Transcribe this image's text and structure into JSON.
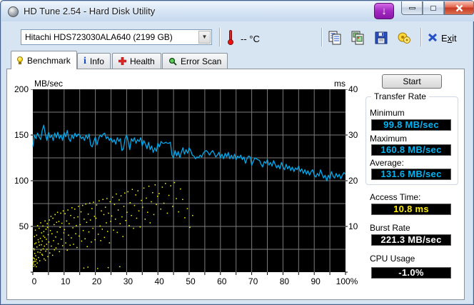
{
  "window": {
    "title": "HD Tune 2.54 - Hard Disk Utility"
  },
  "titlebar_icons": [
    "app-icon",
    "download-icon",
    "minimize-icon",
    "maximize-icon",
    "close-icon"
  ],
  "toolbar": {
    "drive_selector_value": "Hitachi HDS723030ALA640 (2199 GB)",
    "temperature_value": "--",
    "temperature_unit": "°C",
    "icons": [
      "thermometer-icon",
      "copy-text-icon",
      "copy-image-icon",
      "save-icon",
      "options-icon",
      "exit-icon"
    ],
    "exit": {
      "pre": "E",
      "accel": "x",
      "post": "it"
    }
  },
  "tabs": [
    {
      "label": "Benchmark",
      "icon": "benchmark-bulb-icon",
      "active": true
    },
    {
      "label": "Info",
      "icon": "info-icon",
      "active": false
    },
    {
      "label": "Health",
      "icon": "health-cross-icon",
      "active": false
    },
    {
      "label": "Error Scan",
      "icon": "error-scan-magnifier-icon",
      "active": false
    }
  ],
  "panel": {
    "start_label": "Start",
    "transfer_rate": {
      "title": "Transfer Rate",
      "minimum_label": "Minimum",
      "minimum_value": "99.8 MB/sec",
      "maximum_label": "Maximum",
      "maximum_value": "160.8 MB/sec",
      "average_label": "Average:",
      "average_value": "131.6 MB/sec"
    },
    "access_time_label": "Access Time:",
    "access_time_value": "10.8 ms",
    "burst_rate_label": "Burst Rate",
    "burst_rate_value": "221.3 MB/sec",
    "cpu_usage_label": "CPU Usage",
    "cpu_usage_value": "-1.0%"
  },
  "colors": {
    "plot_background": "#000000",
    "grid": "#7b7b7b",
    "transfer_line": "#00a8ec",
    "access_scatter": "#ffff00",
    "lcd_cyan": "#00b4f4",
    "lcd_yellow": "#ffec00",
    "lcd_white": "#ffffff"
  },
  "chart_data": {
    "type": "line",
    "title": "HD Tune benchmark: transfer rate line (left axis) + access time scatter (right axis)",
    "left_axis": {
      "label": "MB/sec",
      "min": 0,
      "max": 200,
      "tick_labels": [
        "200",
        "150",
        "100",
        "50"
      ],
      "tick_step": 50,
      "grid_step": 25
    },
    "right_axis": {
      "label": "ms",
      "min": 0,
      "max": 40,
      "tick_labels": [
        "40",
        "30",
        "20",
        "10"
      ],
      "tick_step": 10
    },
    "x_axis": {
      "min": 0,
      "max": 100,
      "tick_labels": [
        "0",
        "10",
        "20",
        "30",
        "40",
        "50",
        "60",
        "70",
        "80",
        "90",
        "100%"
      ],
      "grid_step_percent": 5
    },
    "grid": {
      "on": true,
      "color": "#7b7b7b"
    },
    "series": [
      {
        "name": "transfer-rate",
        "type": "line",
        "axis": "left",
        "color": "#00a8ec",
        "x_start": 0,
        "x_step": 0.5,
        "values_mbs": [
          137,
          150,
          146,
          152,
          148,
          145,
          155,
          160.8,
          151,
          144,
          153,
          147,
          150,
          144,
          152,
          147,
          153,
          146,
          150,
          144,
          153,
          148,
          155,
          146,
          143,
          150,
          146,
          152,
          148,
          151,
          150,
          146,
          148,
          144,
          150,
          146,
          151,
          139,
          137,
          143,
          148,
          139,
          146,
          150,
          148,
          151,
          152,
          146,
          148,
          144,
          147,
          142,
          145,
          140,
          147,
          143,
          146,
          133,
          135,
          146,
          150,
          143,
          134,
          146,
          143,
          147,
          141,
          145,
          143,
          147,
          138,
          144,
          140,
          135,
          142,
          134,
          138,
          131,
          136,
          132,
          141,
          137,
          143,
          141,
          141,
          142,
          141,
          141,
          142,
          128,
          125,
          133,
          127,
          132,
          125,
          131,
          136,
          129,
          134,
          130,
          136,
          133,
          128,
          127,
          124,
          126,
          125,
          128,
          126,
          130,
          132,
          133,
          131,
          128,
          131,
          133,
          130,
          126,
          128,
          131,
          125,
          129,
          124,
          130,
          126,
          131,
          124,
          128,
          124,
          129,
          123,
          127,
          125,
          128,
          123,
          126,
          119,
          124,
          127,
          126,
          117,
          121,
          125,
          124,
          123,
          122,
          118,
          115,
          121,
          119,
          123,
          117,
          120,
          116,
          122,
          118,
          114,
          117,
          113,
          120,
          115,
          112,
          118,
          113,
          116,
          111,
          115,
          110,
          114,
          112,
          116,
          110,
          113,
          108,
          112,
          107,
          111,
          106,
          110,
          112,
          106,
          104,
          108,
          105,
          112,
          107,
          103,
          106,
          99.8,
          106,
          102,
          110,
          105,
          103,
          108,
          104,
          107,
          102,
          106,
          109,
          107
        ]
      },
      {
        "name": "access-time",
        "type": "scatter",
        "axis": "right",
        "color": "#ffff00",
        "points_x_ms": [
          [
            0.2,
            3.1
          ],
          [
            0.3,
            5.2
          ],
          [
            0.4,
            2.4
          ],
          [
            0.5,
            7.8
          ],
          [
            0.6,
            4.1
          ],
          [
            0.8,
            9.2
          ],
          [
            0.9,
            3.6
          ],
          [
            1.0,
            6.4
          ],
          [
            1.1,
            2.8
          ],
          [
            1.2,
            8.1
          ],
          [
            1.3,
            5.5
          ],
          [
            1.5,
            10.2
          ],
          [
            1.6,
            4.4
          ],
          [
            1.7,
            7.1
          ],
          [
            1.8,
            3.2
          ],
          [
            2.0,
            9.6
          ],
          [
            2.1,
            5.9
          ],
          [
            2.2,
            2.5
          ],
          [
            2.4,
            7.4
          ],
          [
            2.5,
            10.8
          ],
          [
            2.6,
            4.8
          ],
          [
            2.8,
            8.6
          ],
          [
            2.9,
            3.9
          ],
          [
            3.0,
            6.8
          ],
          [
            3.2,
            10.1
          ],
          [
            3.3,
            5.1
          ],
          [
            3.5,
            8.9
          ],
          [
            3.6,
            2.9
          ],
          [
            3.8,
            7.6
          ],
          [
            3.9,
            11.2
          ],
          [
            4.1,
            4.6
          ],
          [
            4.2,
            9.4
          ],
          [
            4.4,
            6.1
          ],
          [
            4.6,
            10.6
          ],
          [
            4.8,
            3.4
          ],
          [
            4.9,
            8.2
          ],
          [
            0.1,
            1.8
          ],
          [
            0.2,
            2.2
          ],
          [
            0.3,
            1.3
          ],
          [
            0.5,
            2.9
          ],
          [
            0.7,
            1.6
          ],
          [
            0.9,
            2.4
          ],
          [
            1.1,
            1.2
          ],
          [
            1.4,
            2.0
          ],
          [
            0.4,
            4.9
          ],
          [
            0.6,
            6.2
          ],
          [
            1.9,
            6.6
          ],
          [
            2.3,
            4.3
          ],
          [
            2.7,
            6.0
          ],
          [
            3.1,
            3.7
          ],
          [
            3.4,
            7.9
          ],
          [
            3.7,
            5.7
          ],
          [
            4.0,
            2.6
          ],
          [
            4.3,
            7.2
          ],
          [
            4.5,
            5.0
          ],
          [
            4.7,
            9.8
          ],
          [
            5.1,
            6.6
          ],
          [
            5.3,
            11.4
          ],
          [
            5.4,
            4.2
          ],
          [
            5.6,
            9.1
          ],
          [
            5.8,
            12.2
          ],
          [
            5.9,
            5.7
          ],
          [
            6.1,
            8.4
          ],
          [
            6.3,
            3.7
          ],
          [
            6.4,
            11.8
          ],
          [
            6.6,
            6.9
          ],
          [
            6.8,
            10.4
          ],
          [
            6.9,
            4.9
          ],
          [
            7.1,
            12.6
          ],
          [
            7.3,
            7.7
          ],
          [
            7.4,
            5.3
          ],
          [
            7.6,
            10.9
          ],
          [
            7.8,
            8.8
          ],
          [
            7.9,
            13.1
          ],
          [
            8.1,
            6.2
          ],
          [
            8.3,
            11.1
          ],
          [
            8.5,
            4.5
          ],
          [
            8.7,
            9.8
          ],
          [
            8.9,
            12.9
          ],
          [
            9.1,
            7.2
          ],
          [
            9.3,
            10.7
          ],
          [
            9.5,
            5.8
          ],
          [
            9.7,
            13.4
          ],
          [
            9.9,
            8.6
          ],
          [
            10.1,
            9.3
          ],
          [
            10.3,
            12.8
          ],
          [
            10.5,
            6.4
          ],
          [
            10.8,
            11.2
          ],
          [
            11.0,
            4.8
          ],
          [
            11.2,
            13.6
          ],
          [
            11.4,
            8.1
          ],
          [
            11.6,
            10.6
          ],
          [
            11.9,
            5.9
          ],
          [
            12.1,
            12.4
          ],
          [
            12.3,
            7.5
          ],
          [
            12.5,
            14.1
          ],
          [
            12.8,
            9.7
          ],
          [
            13.0,
            6.1
          ],
          [
            13.2,
            11.9
          ],
          [
            13.4,
            13.8
          ],
          [
            13.7,
            8.4
          ],
          [
            13.9,
            10.2
          ],
          [
            14.1,
            5.4
          ],
          [
            14.4,
            12.1
          ],
          [
            14.6,
            14.4
          ],
          [
            14.8,
            7.9
          ],
          [
            15.1,
            10.4
          ],
          [
            15.4,
            13.2
          ],
          [
            15.6,
            6.8
          ],
          [
            15.9,
            14.6
          ],
          [
            16.1,
            9.1
          ],
          [
            16.4,
            11.6
          ],
          [
            16.7,
            7.3
          ],
          [
            16.9,
            14.9
          ],
          [
            17.2,
            10.9
          ],
          [
            17.4,
            5.6
          ],
          [
            17.7,
            12.7
          ],
          [
            17.9,
            8.8
          ],
          [
            18.2,
            15.1
          ],
          [
            18.4,
            11.4
          ],
          [
            18.7,
            6.6
          ],
          [
            18.9,
            13.9
          ],
          [
            19.2,
            9.6
          ],
          [
            19.4,
            15.3
          ],
          [
            19.7,
            12.2
          ],
          [
            19.9,
            7.1
          ],
          [
            16.3,
            0.9
          ],
          [
            17.6,
            1.1
          ],
          [
            20.7,
            0.8
          ],
          [
            24.1,
            1.0
          ],
          [
            27.8,
            1.2
          ],
          [
            20.2,
            11.8
          ],
          [
            20.4,
            14.7
          ],
          [
            20.9,
            8.3
          ],
          [
            21.2,
            15.6
          ],
          [
            21.5,
            10.1
          ],
          [
            21.7,
            6.9
          ],
          [
            21.9,
            13.4
          ],
          [
            22.2,
            9.4
          ],
          [
            22.4,
            15.9
          ],
          [
            22.7,
            12.6
          ],
          [
            22.9,
            7.6
          ],
          [
            23.2,
            14.2
          ],
          [
            23.5,
            10.8
          ],
          [
            23.7,
            16.1
          ],
          [
            23.9,
            8.9
          ],
          [
            24.2,
            12.9
          ],
          [
            24.5,
            6.4
          ],
          [
            24.7,
            15.4
          ],
          [
            24.9,
            11.1
          ],
          [
            25.2,
            12.3
          ],
          [
            25.5,
            16.4
          ],
          [
            25.8,
            9.2
          ],
          [
            26.1,
            14.8
          ],
          [
            26.4,
            11.6
          ],
          [
            26.7,
            17.1
          ],
          [
            27.0,
            8.7
          ],
          [
            27.3,
            13.6
          ],
          [
            27.6,
            15.8
          ],
          [
            27.9,
            10.6
          ],
          [
            28.2,
            16.7
          ],
          [
            28.5,
            12.1
          ],
          [
            28.8,
            7.8
          ],
          [
            29.1,
            14.4
          ],
          [
            29.4,
            17.3
          ],
          [
            29.7,
            11.3
          ],
          [
            30.1,
            13.1
          ],
          [
            30.4,
            17.6
          ],
          [
            30.8,
            10.2
          ],
          [
            31.1,
            15.2
          ],
          [
            31.5,
            12.4
          ],
          [
            31.8,
            18.1
          ],
          [
            32.2,
            9.6
          ],
          [
            32.5,
            14.6
          ],
          [
            32.9,
            16.9
          ],
          [
            33.2,
            11.8
          ],
          [
            33.6,
            17.8
          ],
          [
            33.9,
            13.4
          ],
          [
            34.3,
            9.9
          ],
          [
            34.7,
            15.7
          ],
          [
            35.1,
            14.2
          ],
          [
            35.5,
            18.4
          ],
          [
            35.9,
            11.6
          ],
          [
            36.3,
            16.2
          ],
          [
            36.7,
            13.1
          ],
          [
            37.1,
            18.8
          ],
          [
            37.5,
            10.8
          ],
          [
            37.9,
            15.4
          ],
          [
            38.3,
            17.4
          ],
          [
            38.7,
            12.6
          ],
          [
            39.1,
            19.1
          ],
          [
            39.5,
            14.8
          ],
          [
            39.9,
            16.6
          ],
          [
            40.4,
            17.2
          ],
          [
            40.9,
            13.8
          ],
          [
            41.4,
            18.6
          ],
          [
            41.9,
            15.1
          ],
          [
            42.4,
            19.4
          ],
          [
            43.0,
            12.9
          ],
          [
            43.5,
            16.8
          ],
          [
            44.1,
            18.9
          ],
          [
            44.7,
            14.4
          ],
          [
            45.3,
            19.6
          ],
          [
            45.9,
            16.1
          ],
          [
            46.6,
            13.2
          ],
          [
            47.2,
            18.2
          ],
          [
            47.9,
            15.9
          ],
          [
            48.6,
            11.9
          ],
          [
            49.4,
            13.9
          ],
          [
            50.2,
            9.8
          ],
          [
            51.1,
            12.4
          ]
        ]
      }
    ]
  }
}
